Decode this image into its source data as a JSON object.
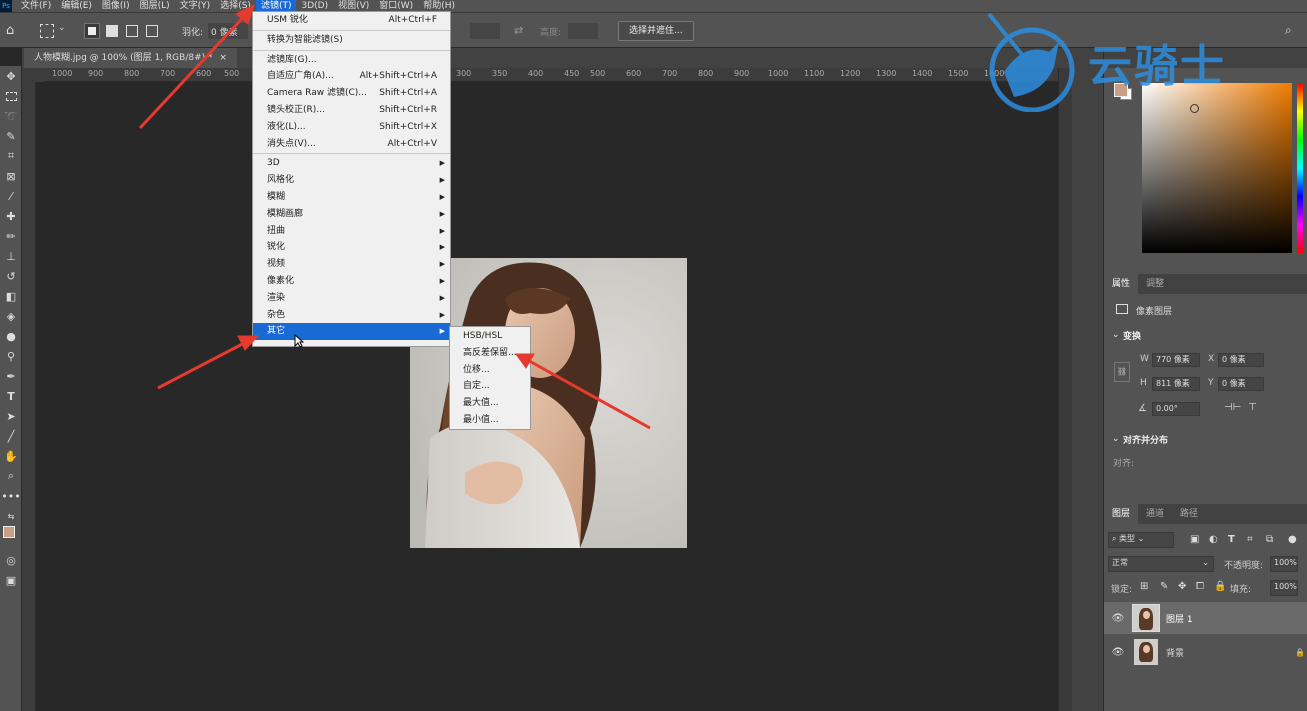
{
  "menubar": {
    "items": [
      "文件(F)",
      "编辑(E)",
      "图像(I)",
      "图层(L)",
      "文字(Y)",
      "选择(S)",
      "滤镜(T)",
      "3D(D)",
      "视图(V)",
      "窗口(W)",
      "帮助(H)"
    ],
    "active_index": 6
  },
  "optionsbar": {
    "feather_label": "羽化:",
    "feather_value": "0 像素",
    "height_label": "高度:",
    "select_mask_button": "选择并遮住..."
  },
  "document": {
    "tab_title": "人物模糊.jpg @ 100% (图层 1, RGB/8#) *"
  },
  "ruler": {
    "left": [
      "1000",
      "900",
      "800",
      "700",
      "600",
      "500"
    ],
    "right": [
      "300",
      "350",
      "400",
      "450",
      "500",
      "600",
      "700",
      "800",
      "900",
      "1000",
      "1100",
      "1200",
      "1300",
      "1400",
      "1500",
      "1600"
    ]
  },
  "filter_menu": {
    "items": [
      {
        "label": "USM 锐化",
        "shortcut": "Alt+Ctrl+F"
      },
      {
        "sep": true
      },
      {
        "label": "转换为智能滤镜(S)",
        "shortcut": ""
      },
      {
        "sep": true
      },
      {
        "label": "滤镜库(G)...",
        "shortcut": ""
      },
      {
        "label": "自适应广角(A)...",
        "shortcut": "Alt+Shift+Ctrl+A"
      },
      {
        "label": "Camera Raw 滤镜(C)...",
        "shortcut": "Shift+Ctrl+A"
      },
      {
        "label": "镜头校正(R)...",
        "shortcut": "Shift+Ctrl+R"
      },
      {
        "label": "液化(L)...",
        "shortcut": "Shift+Ctrl+X"
      },
      {
        "label": "消失点(V)...",
        "shortcut": "Alt+Ctrl+V"
      },
      {
        "sep": true
      },
      {
        "label": "3D",
        "sub": true
      },
      {
        "label": "风格化",
        "sub": true
      },
      {
        "label": "模糊",
        "sub": true
      },
      {
        "label": "模糊画廊",
        "sub": true
      },
      {
        "label": "扭曲",
        "sub": true
      },
      {
        "label": "锐化",
        "sub": true
      },
      {
        "label": "视频",
        "sub": true
      },
      {
        "label": "像素化",
        "sub": true
      },
      {
        "label": "渲染",
        "sub": true
      },
      {
        "label": "杂色",
        "sub": true
      },
      {
        "label": "其它",
        "sub": true,
        "highlight": true
      }
    ]
  },
  "other_submenu": {
    "items": [
      "HSB/HSL",
      "高反差保留...",
      "位移...",
      "自定...",
      "最大值...",
      "最小值..."
    ]
  },
  "watermark": {
    "text": "云骑士"
  },
  "color_panel": {
    "fg_color": "#c9a086",
    "bg_color": "#ffffff",
    "hue_color": "#f07c00"
  },
  "properties": {
    "tabs": [
      "属性",
      "调整"
    ],
    "kind_label": "像素图层",
    "transform_title": "变换",
    "w_label": "W",
    "w_value": "770 像素",
    "h_label": "H",
    "h_value": "811 像素",
    "x_label": "X",
    "x_value": "0 像素",
    "y_label": "Y",
    "y_value": "0 像素",
    "angle_value": "0.00°",
    "align_title": "对齐并分布",
    "align_label": "对齐:"
  },
  "layers_panel": {
    "tabs": [
      "图层",
      "通道",
      "路径"
    ],
    "filter_kind": "类型",
    "blend_mode": "正常",
    "opacity_label": "不透明度:",
    "opacity_value": "100%",
    "lock_label": "锁定:",
    "fill_label": "填充:",
    "fill_value": "100%",
    "layers": [
      {
        "name": "图层 1",
        "selected": true
      },
      {
        "name": "背景",
        "selected": false
      }
    ]
  }
}
